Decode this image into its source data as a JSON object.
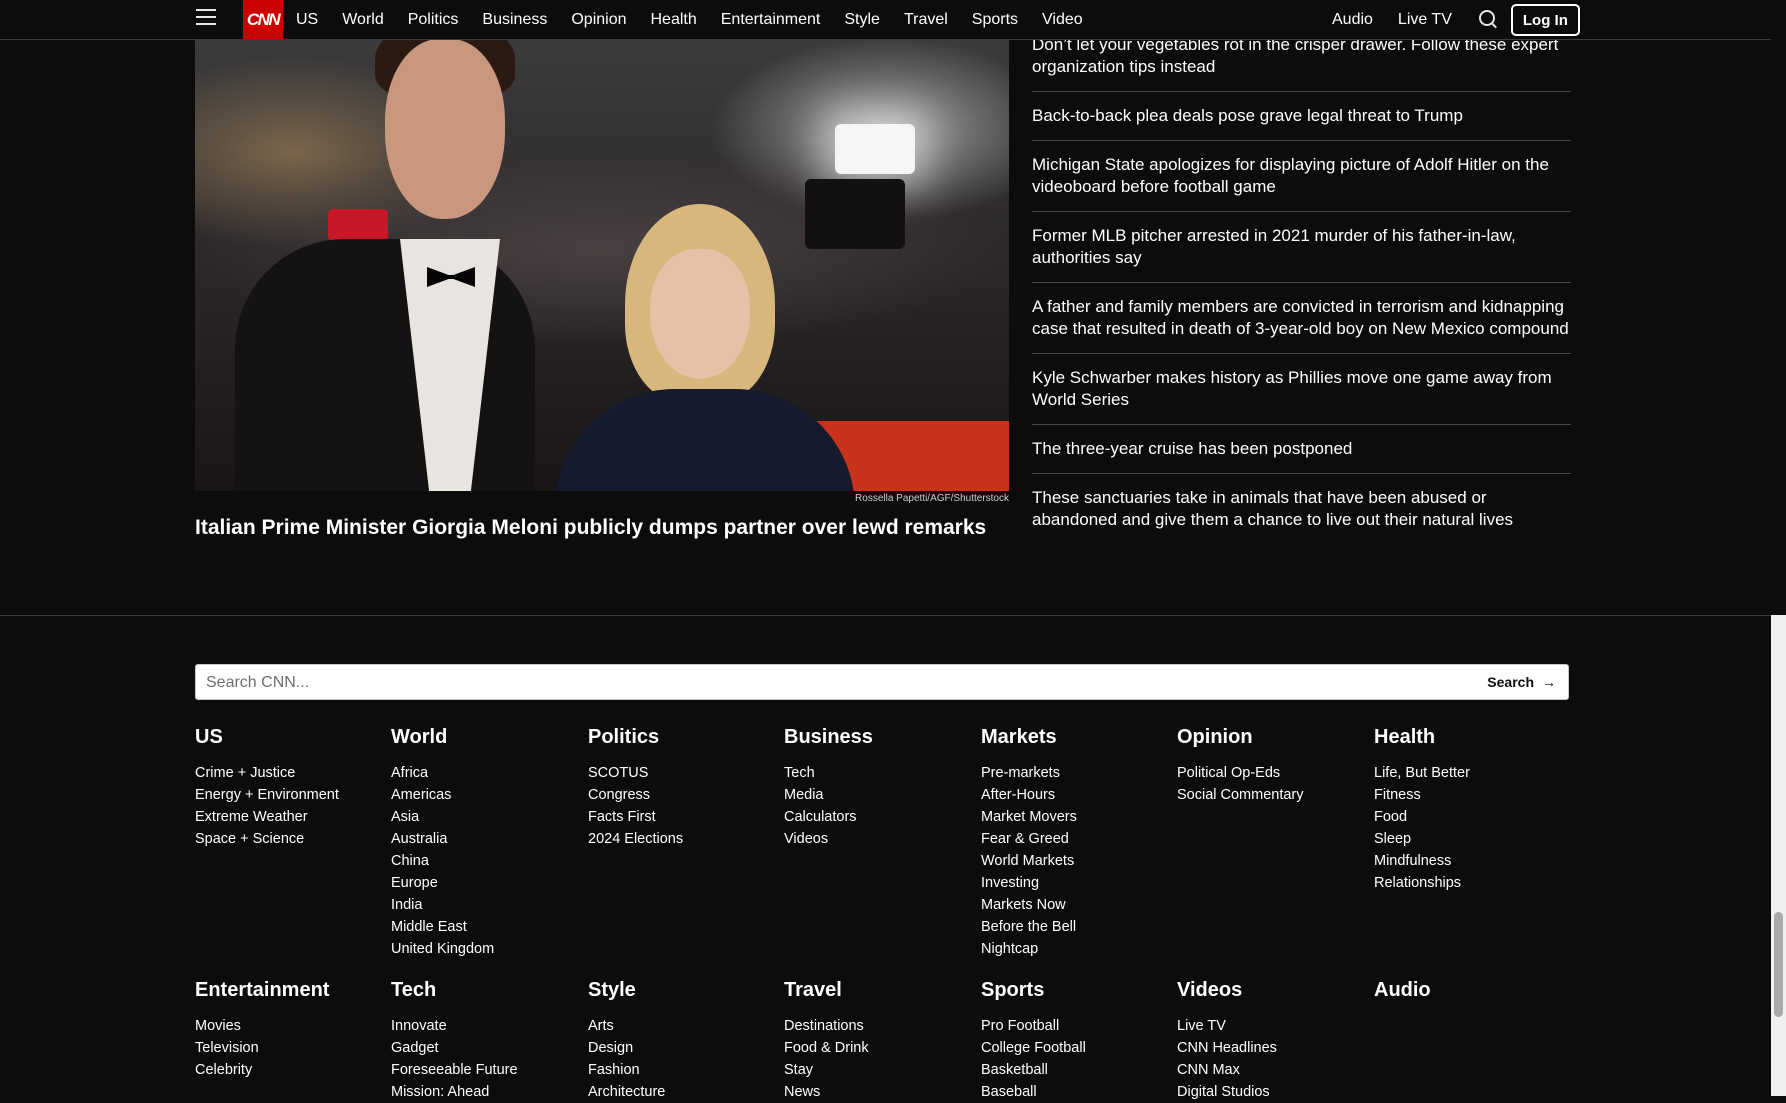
{
  "nav": {
    "logo": "CNN",
    "links": [
      "US",
      "World",
      "Politics",
      "Business",
      "Opinion",
      "Health",
      "Entertainment",
      "Style",
      "Travel",
      "Sports",
      "Video"
    ],
    "right_links": [
      "Audio",
      "Live TV"
    ],
    "login": "Log In"
  },
  "hero": {
    "credit": "Rossella Papetti/AGF/Shutterstock",
    "headline": "Italian Prime Minister Giorgia Meloni publicly dumps partner over lewd remarks"
  },
  "headlines": [
    "Don’t let your vegetables rot in the crisper drawer. Follow these expert organization tips instead",
    "Back-to-back plea deals pose grave legal threat to Trump",
    "Michigan State apologizes for displaying picture of Adolf Hitler on the videoboard before football game",
    "Former MLB pitcher arrested in 2021 murder of his father-in-law, authorities say",
    "A father and family members are convicted in terrorism and kidnapping case that resulted in death of 3-year-old boy on New Mexico compound",
    "Kyle Schwarber makes history as Phillies move one game away from World Series",
    "The three-year cruise has been postponed",
    "These sanctuaries take in animals that have been abused or abandoned and give them a chance to live out their natural lives"
  ],
  "footer_search": {
    "placeholder": "Search CNN...",
    "button": "Search"
  },
  "footer_sections": [
    {
      "title": "US",
      "links": [
        "Crime + Justice",
        "Energy + Environment",
        "Extreme Weather",
        "Space + Science"
      ]
    },
    {
      "title": "World",
      "links": [
        "Africa",
        "Americas",
        "Asia",
        "Australia",
        "China",
        "Europe",
        "India",
        "Middle East",
        "United Kingdom"
      ]
    },
    {
      "title": "Politics",
      "links": [
        "SCOTUS",
        "Congress",
        "Facts First",
        "2024 Elections"
      ]
    },
    {
      "title": "Business",
      "links": [
        "Tech",
        "Media",
        "Calculators",
        "Videos"
      ]
    },
    {
      "title": "Markets",
      "links": [
        "Pre-markets",
        "After-Hours",
        "Market Movers",
        "Fear & Greed",
        "World Markets",
        "Investing",
        "Markets Now",
        "Before the Bell",
        "Nightcap"
      ]
    },
    {
      "title": "Opinion",
      "links": [
        "Political Op-Eds",
        "Social Commentary"
      ]
    },
    {
      "title": "Health",
      "links": [
        "Life, But Better",
        "Fitness",
        "Food",
        "Sleep",
        "Mindfulness",
        "Relationships"
      ]
    },
    {
      "title": "Entertainment",
      "links": [
        "Movies",
        "Television",
        "Celebrity"
      ]
    },
    {
      "title": "Tech",
      "links": [
        "Innovate",
        "Gadget",
        "Foreseeable Future",
        "Mission: Ahead"
      ]
    },
    {
      "title": "Style",
      "links": [
        "Arts",
        "Design",
        "Fashion",
        "Architecture"
      ]
    },
    {
      "title": "Travel",
      "links": [
        "Destinations",
        "Food & Drink",
        "Stay",
        "News"
      ]
    },
    {
      "title": "Sports",
      "links": [
        "Pro Football",
        "College Football",
        "Basketball",
        "Baseball"
      ]
    },
    {
      "title": "Videos",
      "links": [
        "Live TV",
        "CNN Headlines",
        "CNN Max",
        "Digital Studios"
      ]
    },
    {
      "title": "Audio",
      "links": []
    }
  ]
}
